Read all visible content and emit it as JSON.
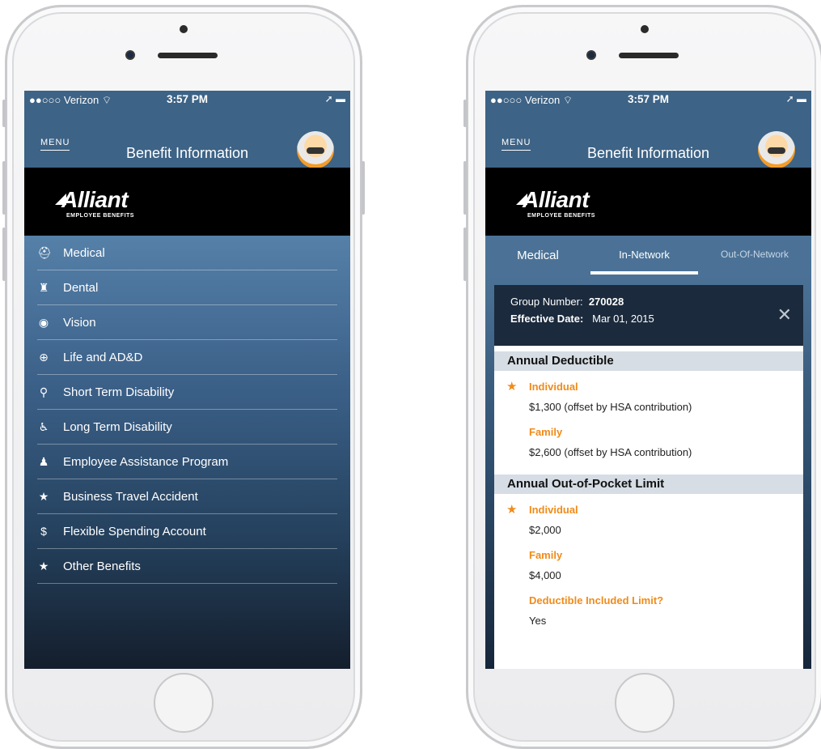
{
  "status": {
    "carrier": "●●○○○ Verizon",
    "wifi_icon": "wifi-icon",
    "time": "3:57 PM",
    "right_icons": "➚ ▬"
  },
  "navbar": {
    "menu_label": "MENU",
    "title": "Benefit Information"
  },
  "brand": {
    "logo_text": "Alliant",
    "logo_sub": "EMPLOYEE BENEFITS"
  },
  "menu": {
    "items": [
      {
        "icon": "medical-kit-icon",
        "glyph": "⛑",
        "label": "Medical"
      },
      {
        "icon": "tooth-icon",
        "glyph": "♜",
        "label": "Dental"
      },
      {
        "icon": "eye-icon",
        "glyph": "◉",
        "label": "Vision"
      },
      {
        "icon": "life-ring-icon",
        "glyph": "⊕",
        "label": "Life and AD&D"
      },
      {
        "icon": "crutch-icon",
        "glyph": "⚲",
        "label": "Short Term Disability"
      },
      {
        "icon": "wheelchair-icon",
        "glyph": "♿",
        "label": "Long Term Disability"
      },
      {
        "icon": "person-icon",
        "glyph": "♟",
        "label": "Employee Assistance Program"
      },
      {
        "icon": "star-icon",
        "glyph": "★",
        "label": "Business Travel Accident"
      },
      {
        "icon": "dollar-icon",
        "glyph": "$",
        "label": "Flexible Spending Account"
      },
      {
        "icon": "star-icon",
        "glyph": "★",
        "label": "Other Benefits"
      }
    ]
  },
  "tabs": [
    {
      "label": "Medical"
    },
    {
      "label": "In-Network"
    },
    {
      "label": "Out-Of-Network"
    }
  ],
  "detail": {
    "group_label": "Group Number:",
    "group_value": "270028",
    "effective_label": "Effective Date:",
    "effective_value": "Mar 01, 2015",
    "close_glyph": "✕",
    "sections": [
      {
        "title": "Annual Deductible",
        "rows": [
          {
            "label": "Individual",
            "value": "$1,300 (offset by HSA contribution)",
            "starred": true
          },
          {
            "label": "Family",
            "value": "$2,600 (offset by HSA contribution)",
            "starred": false
          }
        ]
      },
      {
        "title": "Annual Out-of-Pocket Limit",
        "rows": [
          {
            "label": "Individual",
            "value": "$2,000",
            "starred": true
          },
          {
            "label": "Family",
            "value": "$4,000",
            "starred": false
          },
          {
            "label": "Deductible Included Limit?",
            "value": "Yes",
            "starred": false
          }
        ]
      }
    ]
  },
  "colors": {
    "navbar": "#3d6386",
    "accent_orange": "#f08b1a",
    "section_header": "#d6dde4"
  }
}
